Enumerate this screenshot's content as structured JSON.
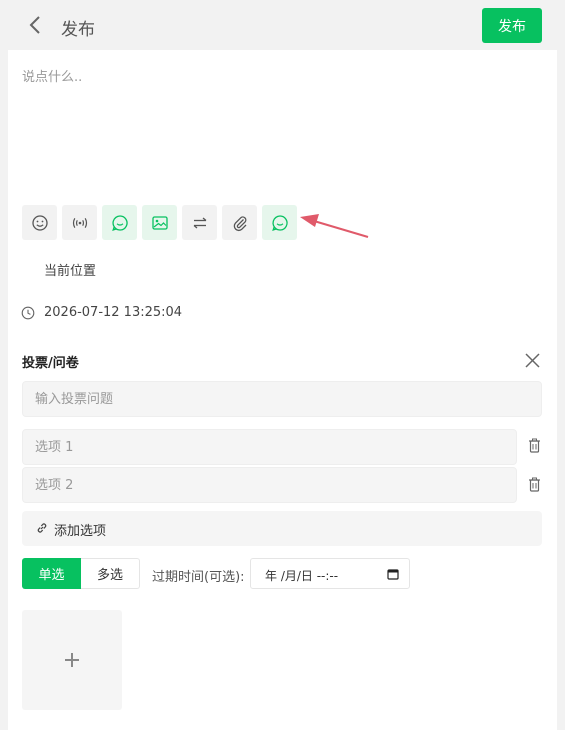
{
  "header": {
    "title": "发布",
    "publish_label": "发布"
  },
  "compose": {
    "placeholder": "说点什么.."
  },
  "toolbar": {
    "icons": [
      "emoji-icon",
      "broadcast-icon",
      "chat-bubble-icon",
      "image-icon",
      "swap-icon",
      "paperclip-icon",
      "chat-bubble-icon"
    ],
    "accent": "#07c160"
  },
  "location": {
    "label": "当前位置"
  },
  "schedule": {
    "datetime": "2026-07-12 13:25:04"
  },
  "vote": {
    "title": "投票/问卷",
    "question_placeholder": "输入投票问题",
    "options": [
      {
        "placeholder": "选项 1"
      },
      {
        "placeholder": "选项 2"
      }
    ],
    "add_option_label": "添加选项",
    "mode_single": "单选",
    "mode_multi": "多选",
    "selected_mode": "单选",
    "expire_label": "过期时间(可选):",
    "expire_value": "年 /月/日  --:--"
  },
  "colors": {
    "brand": "#07c160",
    "annotation_arrow": "#e05a6a"
  }
}
